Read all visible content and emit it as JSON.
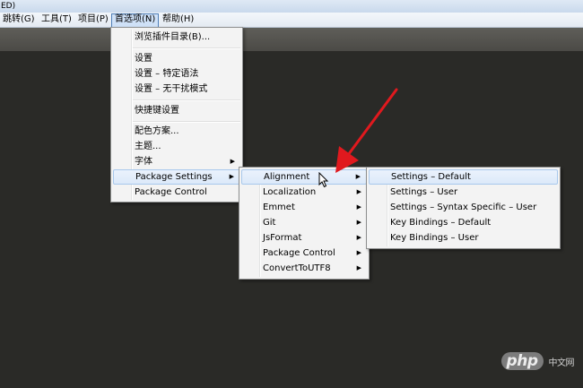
{
  "window": {
    "title_fragment": "ED)"
  },
  "menubar": {
    "items": [
      {
        "label": "跳转(G)"
      },
      {
        "label": "工具(T)"
      },
      {
        "label": "项目(P)"
      },
      {
        "label": "首选项(N)"
      },
      {
        "label": "帮助(H)"
      }
    ]
  },
  "prefs_menu": {
    "items": [
      "浏览插件目录(B)...",
      "设置",
      "设置 – 特定语法",
      "设置 – 无干扰模式",
      "快捷键设置",
      "配色方案...",
      "主题...",
      "字体",
      "Package Settings",
      "Package Control"
    ]
  },
  "package_menu": {
    "items": [
      "Alignment",
      "Localization",
      "Emmet",
      "Git",
      "JsFormat",
      "Package Control",
      "ConvertToUTF8"
    ]
  },
  "alignment_menu": {
    "items": [
      "Settings – Default",
      "Settings – User",
      "Settings – Syntax Specific – User",
      "Key Bindings – Default",
      "Key Bindings – User"
    ]
  },
  "submenu_arrow": "▶",
  "annotation": {
    "arrow_color": "#e0191e"
  },
  "watermark": {
    "badge": "php",
    "text": "中文网"
  }
}
